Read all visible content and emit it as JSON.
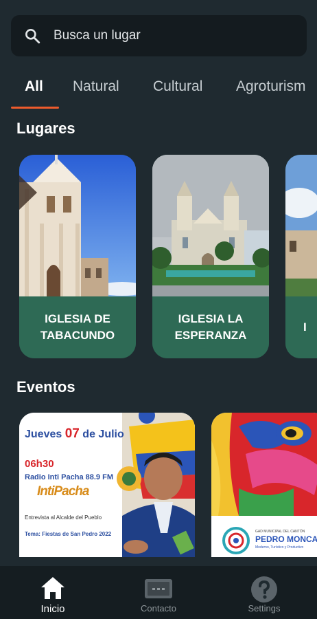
{
  "search": {
    "placeholder": "Busca un lugar"
  },
  "tabs": [
    {
      "label": "All",
      "active": true
    },
    {
      "label": "Natural",
      "active": false
    },
    {
      "label": "Cultural",
      "active": false
    },
    {
      "label": "Agroturism",
      "active": false
    }
  ],
  "sections": {
    "places_title": "Lugares",
    "events_title": "Eventos"
  },
  "places": [
    {
      "name": "IGLESIA DE TABACUNDO"
    },
    {
      "name": "IGLESIA LA ESPERANZA"
    },
    {
      "name": "I"
    }
  ],
  "events": [
    {
      "date_prefix": "Jueves ",
      "date_day": "07",
      "date_suffix": " de Julio",
      "time": "06h30",
      "station": "Radio Inti Pacha 88.9 FM",
      "logo": "IntiPacha",
      "interview": "Entrevista al Alcalde del Pueblo",
      "theme": "Tema: Fiestas de San Pedro 2022"
    },
    {
      "org_small": "GAD MUNICIPAL DEL CANTÓN",
      "org_name": "PEDRO MONCA",
      "org_tagline": "Moderno, Turístico y Productivo"
    }
  ],
  "nav": [
    {
      "label": "Inicio",
      "icon": "home-icon",
      "active": true
    },
    {
      "label": "Contacto",
      "icon": "message-icon",
      "active": false
    },
    {
      "label": "Settings",
      "icon": "help-icon",
      "active": false
    }
  ],
  "colors": {
    "background": "#1f2a30",
    "accent": "#ee5b2c",
    "card_green": "#2e6a55",
    "nav_bg": "#151d21"
  }
}
